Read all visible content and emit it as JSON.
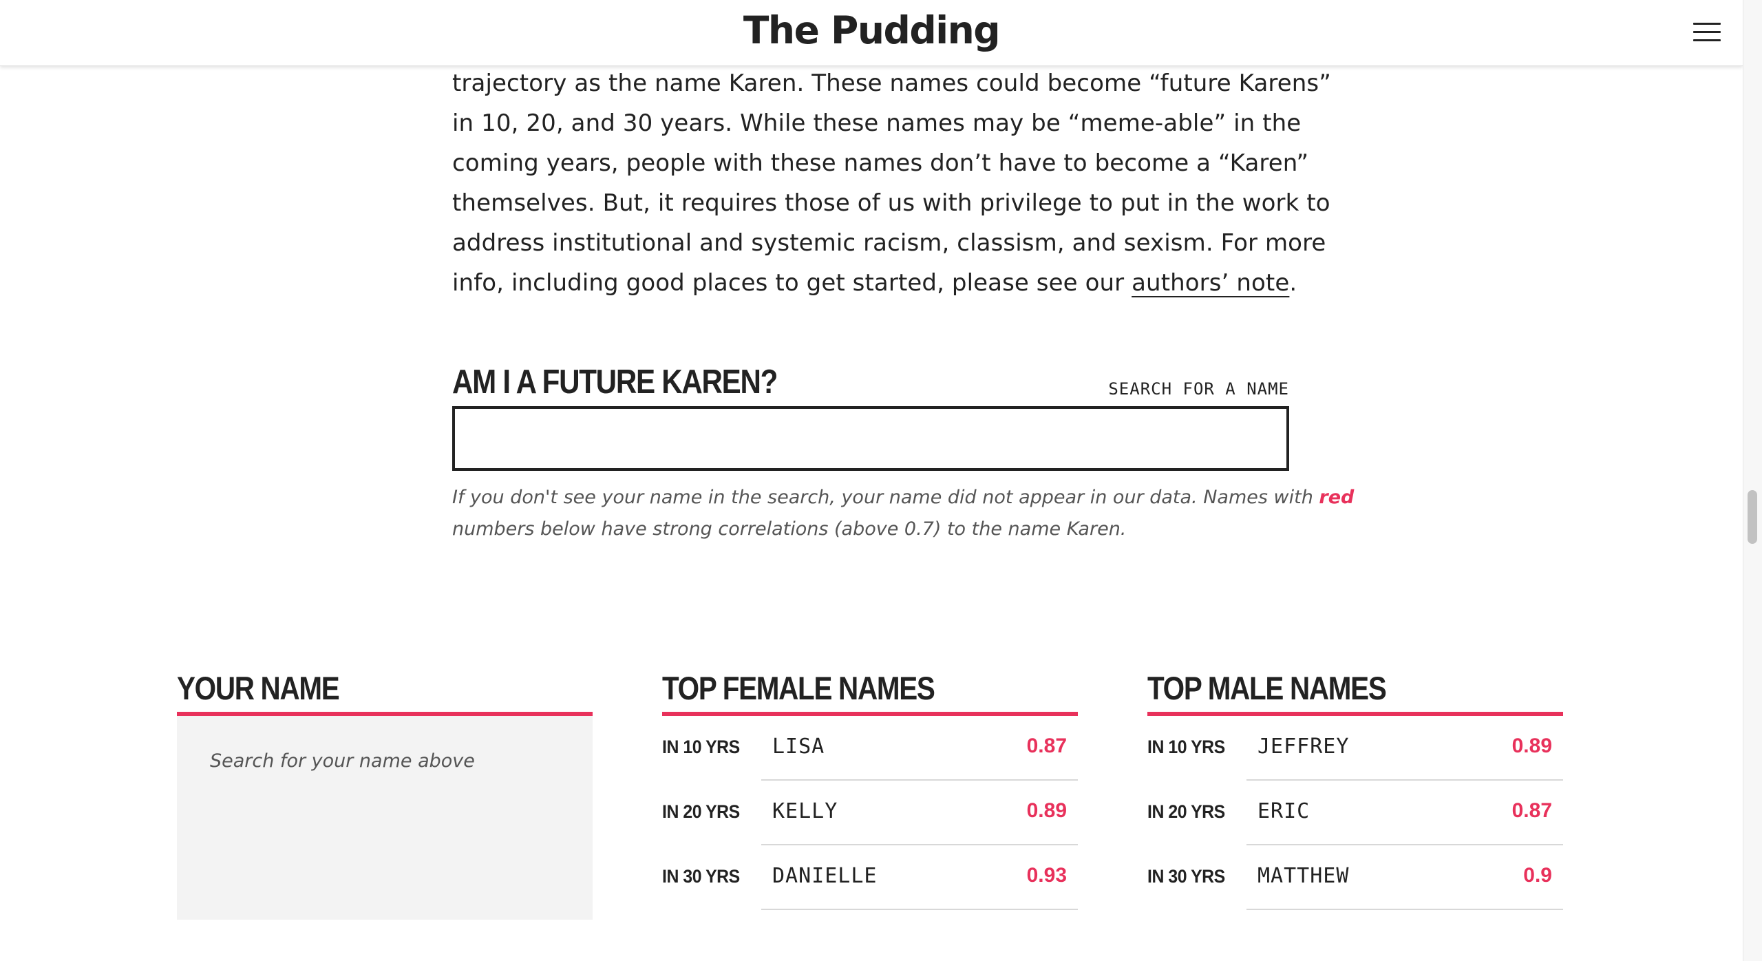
{
  "header": {
    "logo": "The Pudding",
    "menu_icon": "hamburger-menu-icon"
  },
  "prose": {
    "lines": [
      "trajectory as the name Karen. These names could become “future Karens”",
      "in 10, 20, and 30 years. While these names may be “meme-able” in the",
      "coming years, people with these names don’t have to become a “Karen”",
      "themselves. But, it requires those of us with privilege to put in the work to",
      "address institutional and systemic racism, classism, and sexism. For more"
    ],
    "last_line_prefix": "info, including good places to get started, please see our ",
    "link_text": "authors’ note",
    "last_line_suffix": "."
  },
  "search": {
    "title": "AM I A FUTURE KAREN?",
    "label": "SEARCH FOR A NAME",
    "input_value": "",
    "note_part1": "If you don't see your name in the search, your name did not appear in our data. Names with ",
    "note_red": "red",
    "note_part2": "numbers below have strong correlations (above 0.7) to the name Karen."
  },
  "your_name": {
    "title": "YOUR NAME",
    "placeholder": "Search for your name above"
  },
  "top_female": {
    "title": "TOP FEMALE NAMES",
    "rows": [
      {
        "label": "IN 10 YRS",
        "name": "LISA",
        "score": "0.87"
      },
      {
        "label": "IN 20 YRS",
        "name": "KELLY",
        "score": "0.89"
      },
      {
        "label": "IN 30 YRS",
        "name": "DANIELLE",
        "score": "0.93"
      }
    ]
  },
  "top_male": {
    "title": "TOP MALE NAMES",
    "rows": [
      {
        "label": "IN 10 YRS",
        "name": "JEFFREY",
        "score": "0.89"
      },
      {
        "label": "IN 20 YRS",
        "name": "ERIC",
        "score": "0.87"
      },
      {
        "label": "IN 30 YRS",
        "name": "MATTHEW",
        "score": "0.9"
      }
    ]
  },
  "colors": {
    "accent": "#e8315b",
    "text": "#222222",
    "muted": "#555555",
    "panel": "#f3f3f3"
  }
}
